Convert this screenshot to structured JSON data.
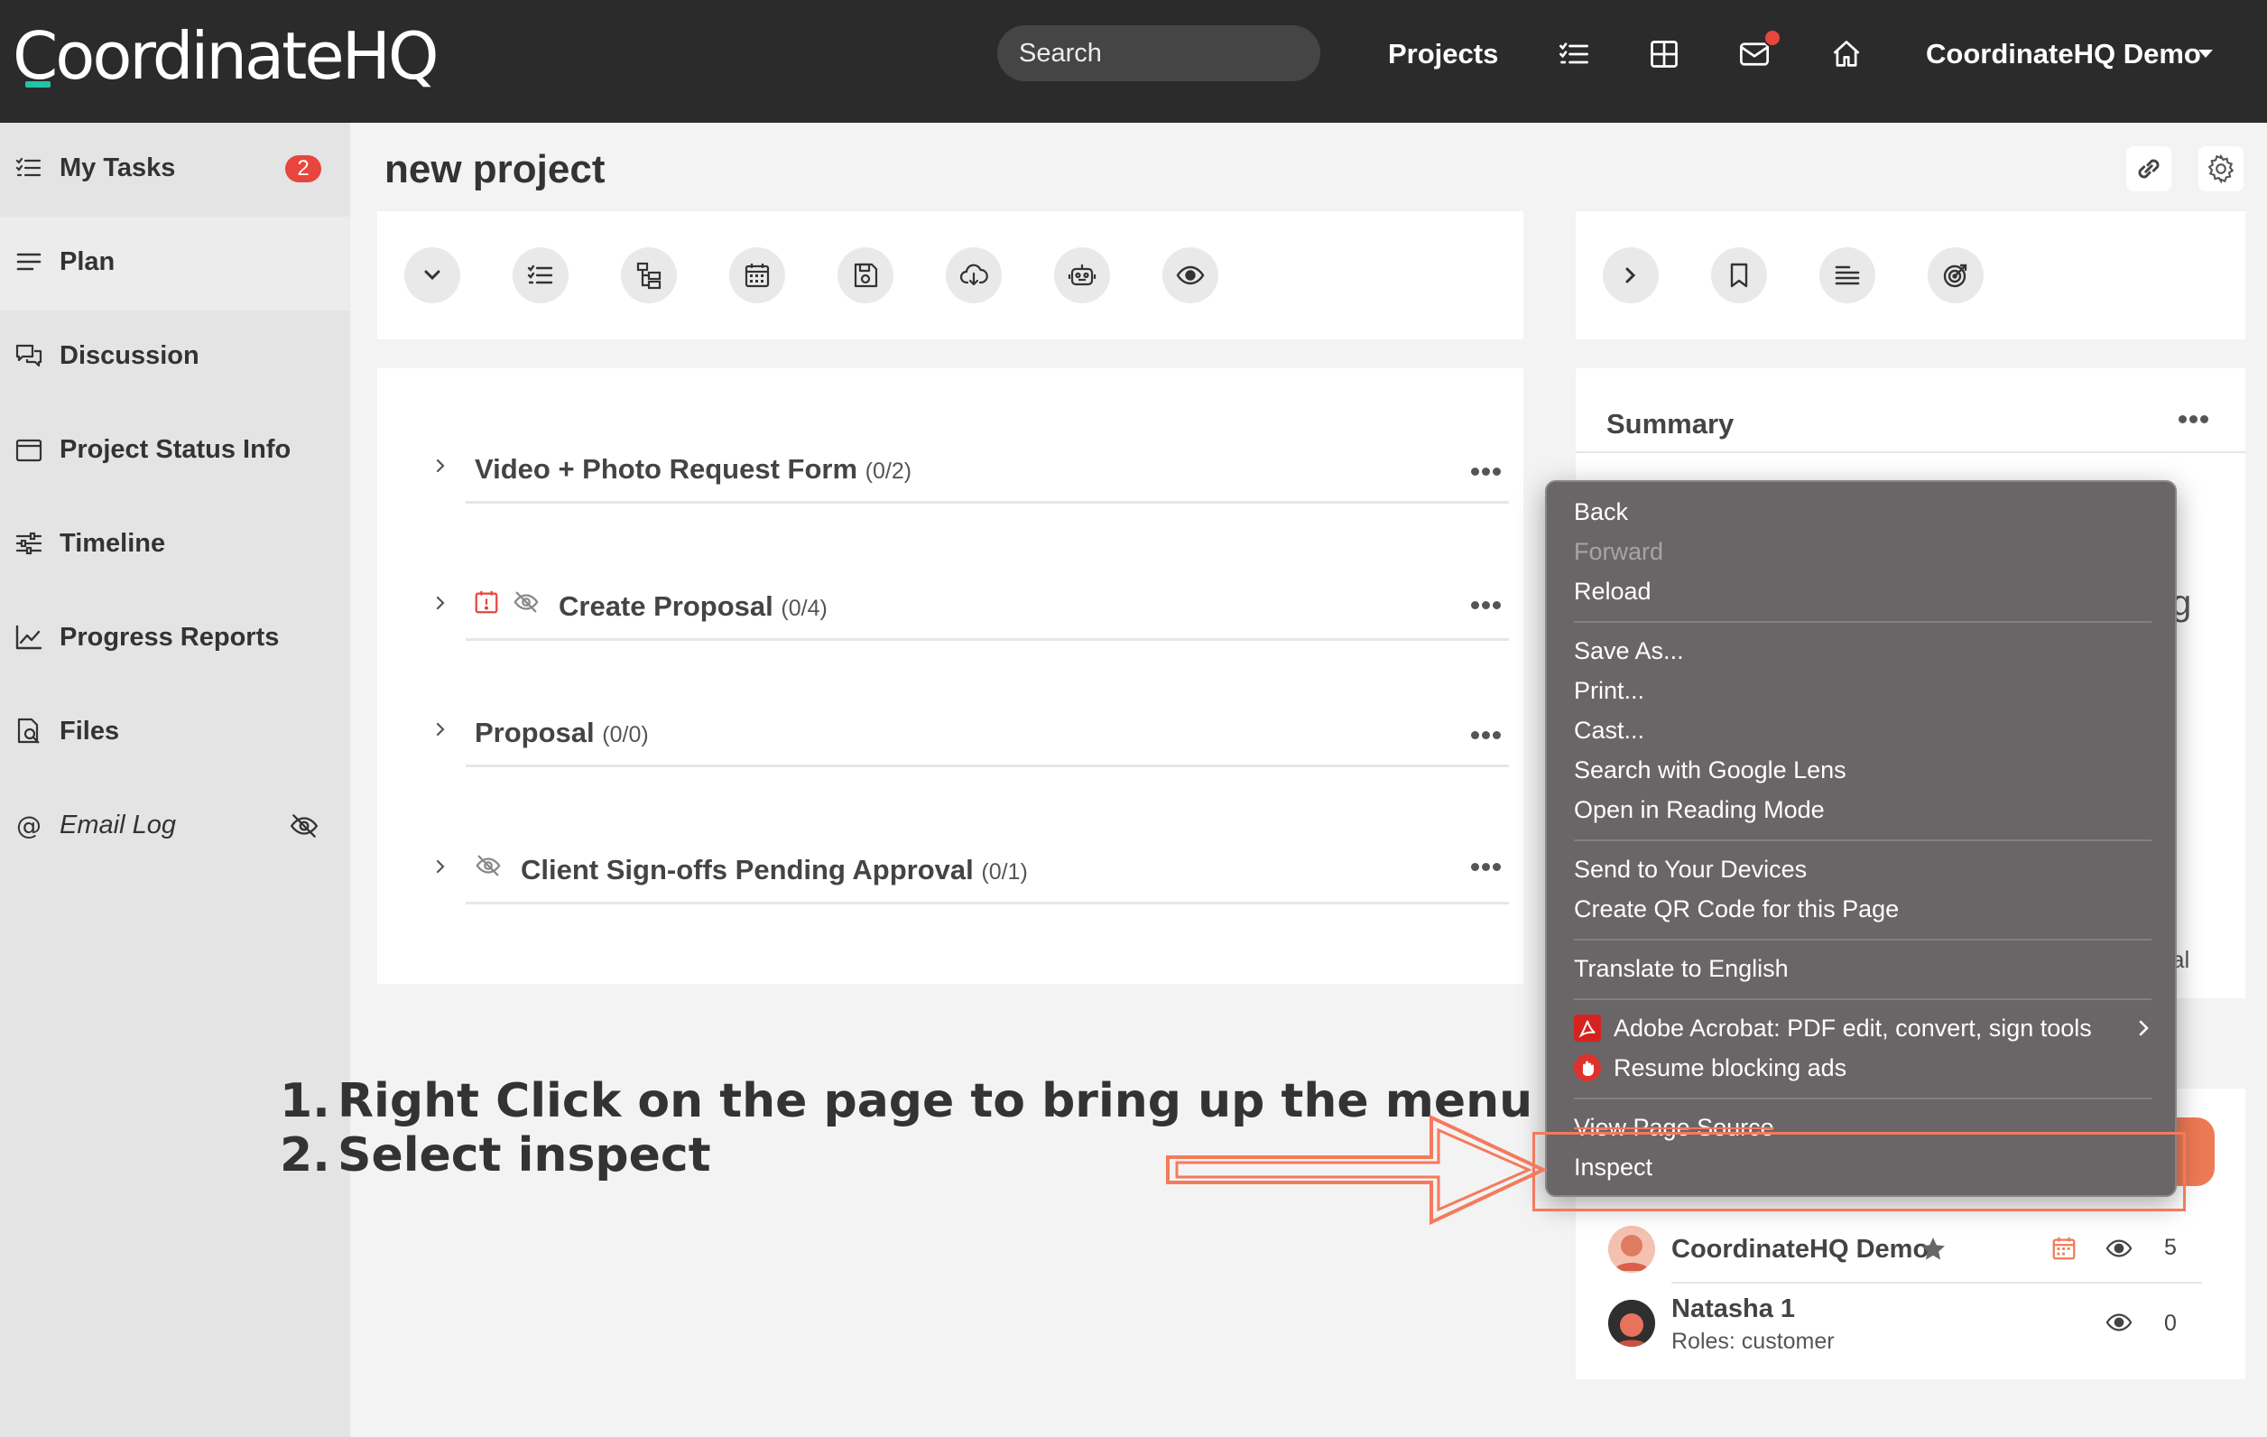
{
  "brand": {
    "logo_text": "CoordinateHQ"
  },
  "topnav": {
    "search_placeholder": "Search",
    "projects_label": "Projects",
    "user_label": "CoordinateHQ Demo",
    "icons": [
      "tasks-icon",
      "grid-icon",
      "mail-icon",
      "home-icon",
      "caret-down-icon"
    ]
  },
  "sidebar": {
    "items": [
      {
        "label": "My Tasks",
        "icon": "tasks-icon",
        "badge": "2"
      },
      {
        "label": "Plan",
        "icon": "menu-icon",
        "active": true
      },
      {
        "label": "Discussion",
        "icon": "chat-icon"
      },
      {
        "label": "Project Status Info",
        "icon": "calendar-icon"
      },
      {
        "label": "Timeline",
        "icon": "sliders-icon"
      },
      {
        "label": "Progress Reports",
        "icon": "chart-icon"
      },
      {
        "label": "Files",
        "icon": "file-search-icon"
      },
      {
        "label": "Email Log",
        "icon": "at-icon",
        "hidden_icon": "eye-off-icon"
      }
    ]
  },
  "page": {
    "title": "new project"
  },
  "toolbar_icons": [
    "collapse-icon",
    "checklist-icon",
    "hierarchy-icon",
    "calendar-icon",
    "save-icon",
    "cloud-download-icon",
    "robot-icon",
    "eye-icon"
  ],
  "right_toolbar_icons": [
    "chevron-right-icon",
    "bookmark-icon",
    "align-left-icon",
    "target-icon"
  ],
  "groups": [
    {
      "title": "Video + Photo Request Form",
      "count": "(0/2)"
    },
    {
      "title": "Create Proposal",
      "count": "(0/4)",
      "icons": [
        "calendar-alert-icon",
        "eye-off-icon"
      ]
    },
    {
      "title": "Proposal",
      "count": "(0/0)"
    },
    {
      "title": "Client Sign-offs Pending Approval",
      "count": "(0/1)",
      "icons": [
        "eye-off-icon"
      ]
    }
  ],
  "summary": {
    "title": "Summary",
    "peek_letter_1": "g",
    "peek_letter_2": "al"
  },
  "members": [
    {
      "name": "CoordinateHQ Demo",
      "count": "5",
      "icons": [
        "star-icon",
        "calendar-icon",
        "eye-icon"
      ]
    },
    {
      "name": "Natasha 1",
      "role": "Roles: customer",
      "count": "0",
      "icons": [
        "eye-icon"
      ]
    }
  ],
  "context_menu": {
    "items": [
      {
        "label": "Back"
      },
      {
        "label": "Forward",
        "disabled": true
      },
      {
        "label": "Reload"
      },
      {
        "label": "Save As..."
      },
      {
        "label": "Print..."
      },
      {
        "label": "Cast..."
      },
      {
        "label": "Search with Google Lens"
      },
      {
        "label": "Open in Reading Mode"
      },
      {
        "label": "Send to Your Devices"
      },
      {
        "label": "Create QR Code for this Page"
      },
      {
        "label": "Translate to English"
      },
      {
        "label": "Adobe Acrobat: PDF edit, convert, sign tools",
        "icon": "acrobat-icon",
        "submenu": true
      },
      {
        "label": "Resume blocking ads",
        "icon": "adblock-icon"
      },
      {
        "label": "View Page Source"
      },
      {
        "label": "Inspect",
        "highlighted": true
      }
    ]
  },
  "annotation": {
    "step1_num": "1.",
    "step1_text": "Right Click on the page to bring up the menu",
    "step2_num": "2.",
    "step2_text": "Select inspect"
  },
  "colors": {
    "topbar": "#2b2b2b",
    "accent": "#22c4a8",
    "badge": "#e8453c",
    "highlight": "#f47a5c",
    "menu_bg": "#6a6566"
  }
}
